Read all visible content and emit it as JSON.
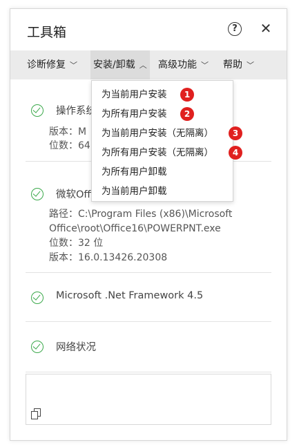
{
  "window": {
    "title": "工具箱",
    "help_icon": "?",
    "close_icon": "✕"
  },
  "menubar": {
    "items": [
      {
        "label": "诊断修复",
        "chevron": "﹀"
      },
      {
        "label": "安装/卸载",
        "chevron": "︿"
      },
      {
        "label": "高级功能",
        "chevron": "﹀"
      },
      {
        "label": "帮助",
        "chevron": "﹀"
      }
    ]
  },
  "dropdown": {
    "items": [
      {
        "label": "为当前用户安装",
        "badge": "1"
      },
      {
        "label": "为所有用户安装",
        "badge": "2"
      },
      {
        "label": "为当前用户安装（无隔离）",
        "badge": "3"
      },
      {
        "label": "为所有用户安装（无隔离）",
        "badge": "4"
      },
      {
        "label": "为所有用户卸载",
        "badge": ""
      },
      {
        "label": "为当前用户卸载",
        "badge": ""
      }
    ],
    "badge_color": "#e0201f"
  },
  "sections": {
    "os": {
      "title": "操作系统",
      "line1": "版本：M",
      "line2": "位数：64"
    },
    "office": {
      "title": "微软Office",
      "path1": "路径：C:\\Program Files (x86)\\Microsoft",
      "path2": "Office\\root\\Office16\\POWERPNT.exe",
      "bits": "位数：32 位",
      "version": "版本：16.0.13426.20308"
    },
    "dotnet": {
      "title": "Microsoft .Net Framework 4.5"
    },
    "network": {
      "title": "网络状况"
    }
  },
  "colors": {
    "check_green": "#3aa84a",
    "menubar_bg": "#ebebeb"
  }
}
